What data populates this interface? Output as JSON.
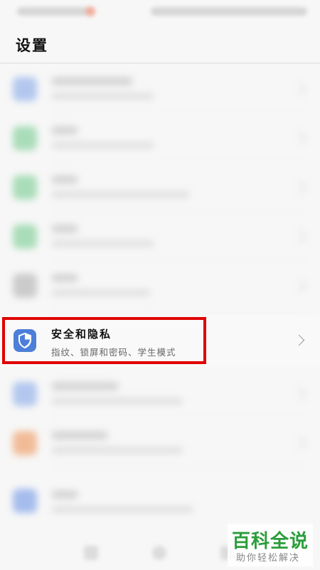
{
  "header": {
    "title": "设置"
  },
  "blurred_rows": [
    {
      "icon_color": "#9cb8ec"
    },
    {
      "icon_color": "#8fd4a4"
    },
    {
      "icon_color": "#8fd4a4"
    },
    {
      "icon_color": "#8fd4a4"
    },
    {
      "icon_color": "#bdbdbd"
    }
  ],
  "highlighted_item": {
    "title": "安全和隐私",
    "subtitle": "指纹、锁屏和密码、学生模式",
    "icon": "shield-icon",
    "icon_color": "#4d7fd9",
    "highlight_color": "#e00000"
  },
  "blurred_rows_below": [
    {
      "icon_color": "#9cb8ec"
    },
    {
      "icon_color": "#f0a878"
    }
  ],
  "blurred_row_bottom": {
    "icon_color": "#8aa9ea"
  },
  "watermark": {
    "title": "百科全说",
    "subtitle": "助你轻松解决",
    "color": "#2a9d3a"
  }
}
